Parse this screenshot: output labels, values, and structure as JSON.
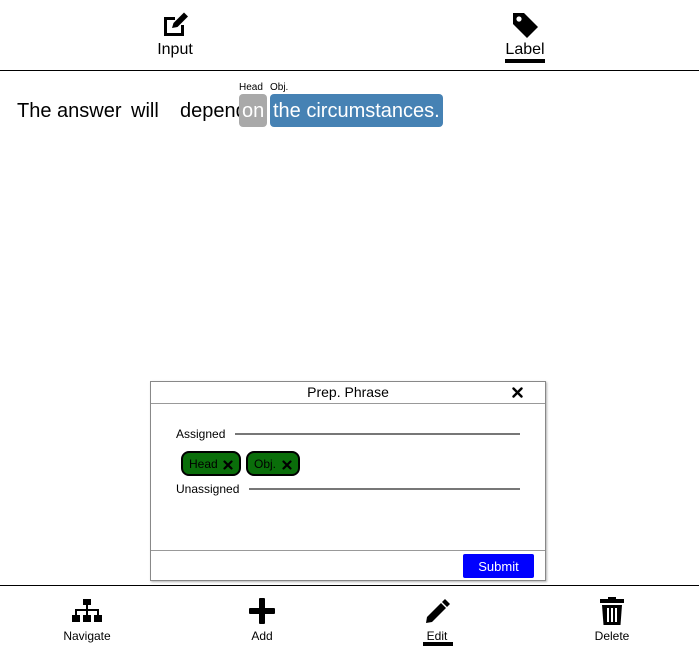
{
  "top_nav": {
    "tabs": [
      {
        "label": "Input",
        "icon": "edit-icon",
        "active": false
      },
      {
        "label": "Label",
        "icon": "tag-icon",
        "active": true
      }
    ]
  },
  "sentence": {
    "words": [
      "The",
      "answer",
      "will",
      "depend",
      "on",
      "the circumstances."
    ],
    "annotations": [
      {
        "word": "on",
        "tag": "Head",
        "color": "#a9a9a9"
      },
      {
        "word": "the circumstances.",
        "tag": "Obj.",
        "color": "#4682b4"
      }
    ]
  },
  "dialog": {
    "title": "Prep. Phrase",
    "assigned_label": "Assigned",
    "unassigned_label": "Unassigned",
    "assigned_chips": [
      {
        "label": "Head",
        "color": "#0a6e0a"
      },
      {
        "label": "Obj.",
        "color": "#0a6e0a"
      }
    ],
    "submit_label": "Submit",
    "submit_color": "#0000ff"
  },
  "bottom_bar": {
    "items": [
      {
        "label": "Navigate",
        "icon": "sitemap-icon",
        "active": false
      },
      {
        "label": "Add",
        "icon": "plus-icon",
        "active": false
      },
      {
        "label": "Edit",
        "icon": "pen-icon",
        "active": true
      },
      {
        "label": "Delete",
        "icon": "trash-icon",
        "active": false
      }
    ]
  }
}
